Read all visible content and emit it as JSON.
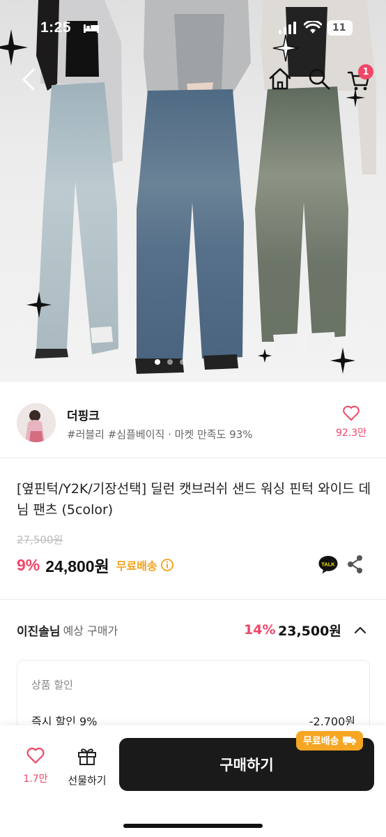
{
  "status_bar": {
    "time": "1:25",
    "battery": "11"
  },
  "top_nav": {
    "cart_count": "1"
  },
  "gallery": {
    "slide_count": 3,
    "active_slide": 1
  },
  "shop": {
    "name": "더핑크",
    "meta": "#러블리 #심플베이직 · 마켓 만족도 93%",
    "likes": "92.3만"
  },
  "product": {
    "title": "[옆핀턱/Y2K/기장선택] 딜런 캣브러쉬 샌드 워싱 핀턱 와이드 데님 팬츠 (5color)",
    "original_price": "27,500원",
    "discount_rate": "9%",
    "price": "24,800원",
    "shipping": "무료배송",
    "kakao_label": "TALK"
  },
  "estimate": {
    "user": "이진솔님",
    "label": "예상 구매가",
    "discount_rate": "14%",
    "amount": "23,500원",
    "section_title": "상품 할인",
    "rows": [
      {
        "label": "즉시 할인 9%",
        "value": "-2,700원"
      }
    ]
  },
  "bottom_bar": {
    "likes": "1.7만",
    "gift_label": "선물하기",
    "buy_label": "구매하기",
    "free_badge": "무료배송"
  },
  "colors": {
    "accent_pink": "#f04668",
    "shipping_orange": "#f0a21a",
    "buy_button": "#1a1a1a",
    "kakao_yellow": "#f7e600"
  }
}
